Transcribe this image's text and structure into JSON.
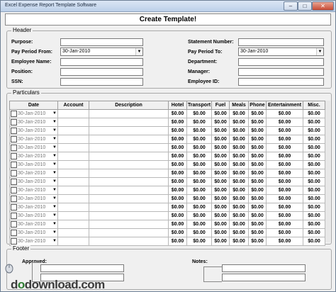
{
  "window": {
    "title": "Excel Expense Report Template Software"
  },
  "create_button": "Create Template!",
  "header": {
    "legend": "Header",
    "purpose_label": "Purpose:",
    "pay_from_label": "Pay Period From:",
    "pay_from_value": "30-Jan-2010",
    "employee_name_label": "Employee Name:",
    "position_label": "Position:",
    "ssn_label": "SSN:",
    "statement_label": "Statement Number:",
    "pay_to_label": "Pay Period To:",
    "pay_to_value": "30-Jan-2010",
    "department_label": "Department:",
    "manager_label": "Manager:",
    "employee_id_label": "Employee ID:"
  },
  "particulars": {
    "legend": "Particulars",
    "columns": [
      "Date",
      "Account",
      "Description",
      "Hotel",
      "Transport",
      "Fuel",
      "Meals",
      "Phone",
      "Entertainment",
      "Misc."
    ],
    "rows": [
      {
        "date": "30-Jan-2010",
        "hotel": "$0.00",
        "transport": "$0.00",
        "fuel": "$0.00",
        "meals": "$0.00",
        "phone": "$0.00",
        "entertainment": "$0.00",
        "misc": "$0.00"
      },
      {
        "date": "30-Jan-2010",
        "hotel": "$0.00",
        "transport": "$0.00",
        "fuel": "$0.00",
        "meals": "$0.00",
        "phone": "$0.00",
        "entertainment": "$0.00",
        "misc": "$0.00"
      },
      {
        "date": "30-Jan-2010",
        "hotel": "$0.00",
        "transport": "$0.00",
        "fuel": "$0.00",
        "meals": "$0.00",
        "phone": "$0.00",
        "entertainment": "$0.00",
        "misc": "$0.00"
      },
      {
        "date": "30-Jan-2010",
        "hotel": "$0.00",
        "transport": "$0.00",
        "fuel": "$0.00",
        "meals": "$0.00",
        "phone": "$0.00",
        "entertainment": "$0.00",
        "misc": "$0.00"
      },
      {
        "date": "30-Jan-2010",
        "hotel": "$0.00",
        "transport": "$0.00",
        "fuel": "$0.00",
        "meals": "$0.00",
        "phone": "$0.00",
        "entertainment": "$0.00",
        "misc": "$0.00"
      },
      {
        "date": "30-Jan-2010",
        "hotel": "$0.00",
        "transport": "$0.00",
        "fuel": "$0.00",
        "meals": "$0.00",
        "phone": "$0.00",
        "entertainment": "$0.00",
        "misc": "$0.00"
      },
      {
        "date": "30-Jan-2010",
        "hotel": "$0.00",
        "transport": "$0.00",
        "fuel": "$0.00",
        "meals": "$0.00",
        "phone": "$0.00",
        "entertainment": "$0.00",
        "misc": "$0.00"
      },
      {
        "date": "30-Jan-2010",
        "hotel": "$0.00",
        "transport": "$0.00",
        "fuel": "$0.00",
        "meals": "$0.00",
        "phone": "$0.00",
        "entertainment": "$0.00",
        "misc": "$0.00"
      },
      {
        "date": "30-Jan-2010",
        "hotel": "$0.00",
        "transport": "$0.00",
        "fuel": "$0.00",
        "meals": "$0.00",
        "phone": "$0.00",
        "entertainment": "$0.00",
        "misc": "$0.00"
      },
      {
        "date": "30-Jan-2010",
        "hotel": "$0.00",
        "transport": "$0.00",
        "fuel": "$0.00",
        "meals": "$0.00",
        "phone": "$0.00",
        "entertainment": "$0.00",
        "misc": "$0.00"
      },
      {
        "date": "30-Jan-2010",
        "hotel": "$0.00",
        "transport": "$0.00",
        "fuel": "$0.00",
        "meals": "$0.00",
        "phone": "$0.00",
        "entertainment": "$0.00",
        "misc": "$0.00"
      },
      {
        "date": "30-Jan-2010",
        "hotel": "$0.00",
        "transport": "$0.00",
        "fuel": "$0.00",
        "meals": "$0.00",
        "phone": "$0.00",
        "entertainment": "$0.00",
        "misc": "$0.00"
      },
      {
        "date": "30-Jan-2010",
        "hotel": "$0.00",
        "transport": "$0.00",
        "fuel": "$0.00",
        "meals": "$0.00",
        "phone": "$0.00",
        "entertainment": "$0.00",
        "misc": "$0.00"
      },
      {
        "date": "30-Jan-2010",
        "hotel": "$0.00",
        "transport": "$0.00",
        "fuel": "$0.00",
        "meals": "$0.00",
        "phone": "$0.00",
        "entertainment": "$0.00",
        "misc": "$0.00"
      },
      {
        "date": "30-Jan-2010",
        "hotel": "$0.00",
        "transport": "$0.00",
        "fuel": "$0.00",
        "meals": "$0.00",
        "phone": "$0.00",
        "entertainment": "$0.00",
        "misc": "$0.00"
      },
      {
        "date": "30-Jan-2010",
        "hotel": "$0.00",
        "transport": "$0.00",
        "fuel": "$0.00",
        "meals": "$0.00",
        "phone": "$0.00",
        "entertainment": "$0.00",
        "misc": "$0.00"
      }
    ]
  },
  "footer": {
    "legend": "Footer",
    "approved_label": "Approved:",
    "notes_label": "Notes:"
  },
  "watermark": {
    "text_a": "d",
    "text_o": "o",
    "text_b": "download.com"
  }
}
